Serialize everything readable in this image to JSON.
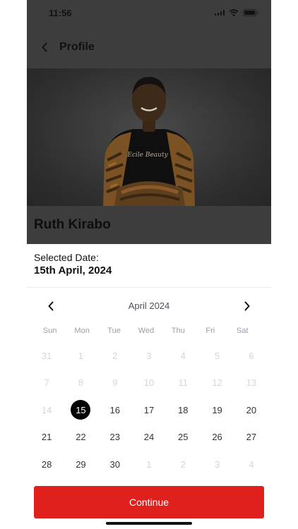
{
  "status_bar": {
    "time": "11:56"
  },
  "nav": {
    "title": "Profile"
  },
  "profile": {
    "name": "Ruth Kirabo",
    "shirt_text": "Ecile Beauty"
  },
  "sheet": {
    "selected_label": "Selected Date:",
    "selected_value": "15th April, 2024",
    "calendar": {
      "month_label": "April 2024",
      "weekdays": [
        "Sun",
        "Mon",
        "Tue",
        "Wed",
        "Thu",
        "Fri",
        "Sat"
      ],
      "selected_day": 15,
      "weeks": [
        [
          {
            "d": "31",
            "m": true
          },
          {
            "d": "1",
            "m": true
          },
          {
            "d": "2",
            "m": true
          },
          {
            "d": "3",
            "m": true
          },
          {
            "d": "4",
            "m": true
          },
          {
            "d": "5",
            "m": true
          },
          {
            "d": "6",
            "m": true
          }
        ],
        [
          {
            "d": "7",
            "m": true
          },
          {
            "d": "8",
            "m": true
          },
          {
            "d": "9",
            "m": true
          },
          {
            "d": "10",
            "m": true
          },
          {
            "d": "11",
            "m": true
          },
          {
            "d": "12",
            "m": true
          },
          {
            "d": "13",
            "m": true
          }
        ],
        [
          {
            "d": "14",
            "m": true
          },
          {
            "d": "15",
            "m": false,
            "s": true
          },
          {
            "d": "16",
            "m": false
          },
          {
            "d": "17",
            "m": false
          },
          {
            "d": "18",
            "m": false
          },
          {
            "d": "19",
            "m": false
          },
          {
            "d": "20",
            "m": false
          }
        ],
        [
          {
            "d": "21",
            "m": false
          },
          {
            "d": "22",
            "m": false
          },
          {
            "d": "23",
            "m": false
          },
          {
            "d": "24",
            "m": false
          },
          {
            "d": "25",
            "m": false
          },
          {
            "d": "26",
            "m": false
          },
          {
            "d": "27",
            "m": false
          }
        ],
        [
          {
            "d": "28",
            "m": false
          },
          {
            "d": "29",
            "m": false
          },
          {
            "d": "30",
            "m": false
          },
          {
            "d": "1",
            "m": true
          },
          {
            "d": "2",
            "m": true
          },
          {
            "d": "3",
            "m": true
          },
          {
            "d": "4",
            "m": true
          }
        ]
      ]
    },
    "continue_label": "Continue"
  },
  "colors": {
    "accent": "#e0201d",
    "selected_day": "#000000",
    "overlay": "#3d3d3d"
  }
}
